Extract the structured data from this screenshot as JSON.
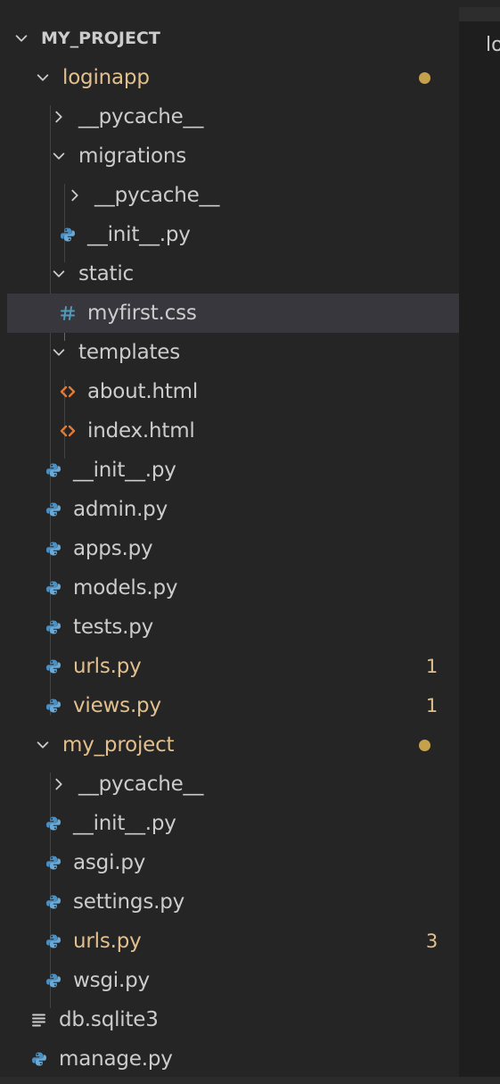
{
  "editor": {
    "partial_text": "lo"
  },
  "explorer": {
    "items": [
      {
        "id": "my-project-root",
        "label": "MY_PROJECT",
        "kind": "header",
        "icon": "chevron-down-icon"
      },
      {
        "id": "loginapp",
        "label": "loginapp",
        "kind": "folder",
        "icon": "chevron-down-icon",
        "modified": true,
        "dot": true
      },
      {
        "id": "loginapp-pycache",
        "label": "__pycache__",
        "kind": "folder",
        "icon": "chevron-right-icon"
      },
      {
        "id": "migrations",
        "label": "migrations",
        "kind": "folder",
        "icon": "chevron-down-icon"
      },
      {
        "id": "migrations-pycache",
        "label": "__pycache__",
        "kind": "folder",
        "icon": "chevron-right-icon"
      },
      {
        "id": "migrations-init",
        "label": "__init__.py",
        "kind": "file",
        "icon": "python-icon"
      },
      {
        "id": "static",
        "label": "static",
        "kind": "folder",
        "icon": "chevron-down-icon"
      },
      {
        "id": "myfirst-css",
        "label": "myfirst.css",
        "kind": "file",
        "icon": "css-hash-icon",
        "selected": true
      },
      {
        "id": "templates",
        "label": "templates",
        "kind": "folder",
        "icon": "chevron-down-icon"
      },
      {
        "id": "about-html",
        "label": "about.html",
        "kind": "file",
        "icon": "html-icon"
      },
      {
        "id": "index-html",
        "label": "index.html",
        "kind": "file",
        "icon": "html-icon"
      },
      {
        "id": "loginapp-init",
        "label": "__init__.py",
        "kind": "file",
        "icon": "python-icon"
      },
      {
        "id": "admin-py",
        "label": "admin.py",
        "kind": "file",
        "icon": "python-icon"
      },
      {
        "id": "apps-py",
        "label": "apps.py",
        "kind": "file",
        "icon": "python-icon"
      },
      {
        "id": "models-py",
        "label": "models.py",
        "kind": "file",
        "icon": "python-icon"
      },
      {
        "id": "tests-py",
        "label": "tests.py",
        "kind": "file",
        "icon": "python-icon"
      },
      {
        "id": "loginapp-urls-py",
        "label": "urls.py",
        "kind": "file",
        "icon": "python-icon",
        "modified": true,
        "badge": "1"
      },
      {
        "id": "views-py",
        "label": "views.py",
        "kind": "file",
        "icon": "python-icon",
        "modified": true,
        "badge": "1"
      },
      {
        "id": "my-project-folder",
        "label": "my_project",
        "kind": "folder",
        "icon": "chevron-down-icon",
        "modified": true,
        "dot": true
      },
      {
        "id": "my-project-pycache",
        "label": "__pycache__",
        "kind": "folder",
        "icon": "chevron-right-icon"
      },
      {
        "id": "my-project-init",
        "label": "__init__.py",
        "kind": "file",
        "icon": "python-icon"
      },
      {
        "id": "asgi-py",
        "label": "asgi.py",
        "kind": "file",
        "icon": "python-icon"
      },
      {
        "id": "settings-py",
        "label": "settings.py",
        "kind": "file",
        "icon": "python-icon"
      },
      {
        "id": "my-project-urls-py",
        "label": "urls.py",
        "kind": "file",
        "icon": "python-icon",
        "modified": true,
        "badge": "3"
      },
      {
        "id": "wsgi-py",
        "label": "wsgi.py",
        "kind": "file",
        "icon": "python-icon"
      },
      {
        "id": "db-sqlite3",
        "label": "db.sqlite3",
        "kind": "file",
        "icon": "text-file-icon"
      },
      {
        "id": "manage-py",
        "label": "manage.py",
        "kind": "file",
        "icon": "python-icon"
      }
    ]
  },
  "colors": {
    "modified": "#e2c08d",
    "python_blue": "#4a90c2",
    "html_orange": "#e37933",
    "css_blue": "#519aba",
    "selected_row": "#37373d"
  }
}
